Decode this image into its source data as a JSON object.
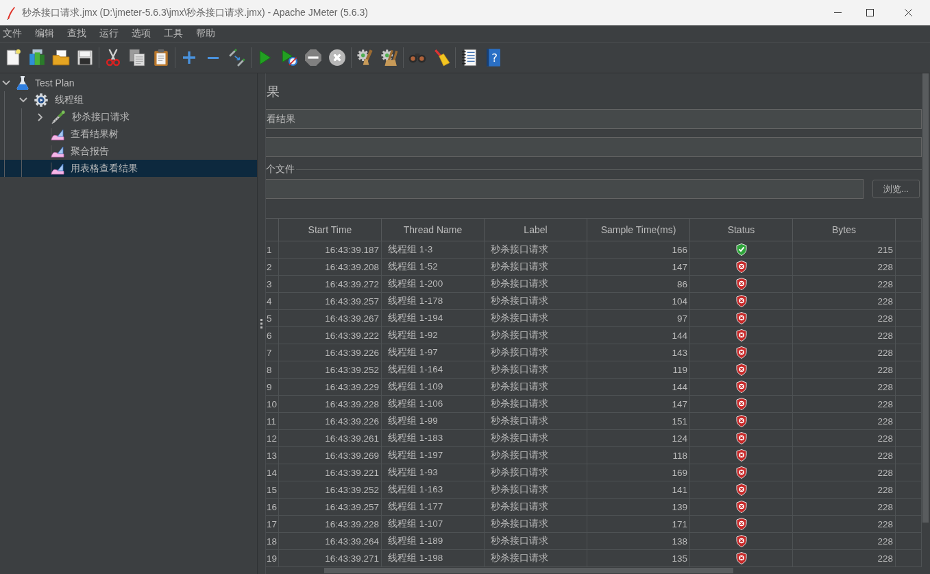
{
  "window": {
    "title": "秒杀接口请求.jmx (D:\\jmeter-5.6.3\\jmx\\秒杀接口请求.jmx) - Apache JMeter (5.6.3)"
  },
  "menu": [
    "文件",
    "编辑",
    "查找",
    "运行",
    "选项",
    "工具",
    "帮助"
  ],
  "toolbar": [
    {
      "buttons": [
        {
          "kind": "new",
          "disabled": false
        },
        {
          "kind": "templates",
          "disabled": false
        },
        {
          "kind": "open",
          "disabled": false
        },
        {
          "kind": "save",
          "disabled": false
        }
      ]
    },
    {
      "buttons": [
        {
          "kind": "cut",
          "disabled": false
        },
        {
          "kind": "copy",
          "disabled": false
        },
        {
          "kind": "paste",
          "disabled": false
        }
      ]
    },
    {
      "buttons": [
        {
          "kind": "expand",
          "disabled": false
        },
        {
          "kind": "collapse",
          "disabled": false
        },
        {
          "kind": "toggle",
          "disabled": false
        }
      ]
    },
    {
      "buttons": [
        {
          "kind": "start",
          "disabled": false
        },
        {
          "kind": "start-no-pauses",
          "disabled": false
        },
        {
          "kind": "stop",
          "disabled": true
        },
        {
          "kind": "shutdown",
          "disabled": true
        }
      ]
    },
    {
      "buttons": [
        {
          "kind": "clear",
          "disabled": false
        },
        {
          "kind": "clear-all",
          "disabled": false
        }
      ]
    },
    {
      "buttons": [
        {
          "kind": "search",
          "disabled": false
        },
        {
          "kind": "reset-search",
          "disabled": false
        }
      ]
    },
    {
      "buttons": [
        {
          "kind": "function-helper",
          "disabled": false
        },
        {
          "kind": "help",
          "disabled": false,
          "glyph": "?"
        }
      ]
    }
  ],
  "tree": [
    {
      "label": "Test Plan",
      "kind": "test-plan",
      "expanded": true,
      "selected": false,
      "children": [
        {
          "label": "线程组",
          "kind": "thread-group",
          "expanded": true,
          "selected": false,
          "children": [
            {
              "label": "秒杀接口请求",
              "kind": "sampler",
              "expanded": false,
              "selected": false
            },
            {
              "label": "查看结果树",
              "kind": "listener",
              "selected": false
            },
            {
              "label": "聚合报告",
              "kind": "listener",
              "selected": false
            },
            {
              "label": "用表格查看结果",
              "kind": "listener",
              "selected": true
            }
          ]
        }
      ]
    }
  ],
  "editor": {
    "title": "果",
    "name_value": "看结果",
    "file_section_label": "个文件",
    "browse_button": "浏览..."
  },
  "table": {
    "columns": [
      "Start Time",
      "Thread Name",
      "Label",
      "Sample Time(ms)",
      "Status",
      "Bytes"
    ],
    "rows": [
      {
        "number": "1",
        "start_time": "16:43:39.187",
        "thread_name": "线程组 1-3",
        "label": "秒杀接口请求",
        "sample_time": "166",
        "success": true,
        "bytes": "215"
      },
      {
        "number": "2",
        "start_time": "16:43:39.208",
        "thread_name": "线程组 1-52",
        "label": "秒杀接口请求",
        "sample_time": "147",
        "success": false,
        "bytes": "228"
      },
      {
        "number": "3",
        "start_time": "16:43:39.272",
        "thread_name": "线程组 1-200",
        "label": "秒杀接口请求",
        "sample_time": "86",
        "success": false,
        "bytes": "228"
      },
      {
        "number": "4",
        "start_time": "16:43:39.257",
        "thread_name": "线程组 1-178",
        "label": "秒杀接口请求",
        "sample_time": "104",
        "success": false,
        "bytes": "228"
      },
      {
        "number": "5",
        "start_time": "16:43:39.267",
        "thread_name": "线程组 1-194",
        "label": "秒杀接口请求",
        "sample_time": "97",
        "success": false,
        "bytes": "228"
      },
      {
        "number": "6",
        "start_time": "16:43:39.222",
        "thread_name": "线程组 1-92",
        "label": "秒杀接口请求",
        "sample_time": "144",
        "success": false,
        "bytes": "228"
      },
      {
        "number": "7",
        "start_time": "16:43:39.226",
        "thread_name": "线程组 1-97",
        "label": "秒杀接口请求",
        "sample_time": "143",
        "success": false,
        "bytes": "228"
      },
      {
        "number": "8",
        "start_time": "16:43:39.252",
        "thread_name": "线程组 1-164",
        "label": "秒杀接口请求",
        "sample_time": "119",
        "success": false,
        "bytes": "228"
      },
      {
        "number": "9",
        "start_time": "16:43:39.229",
        "thread_name": "线程组 1-109",
        "label": "秒杀接口请求",
        "sample_time": "144",
        "success": false,
        "bytes": "228"
      },
      {
        "number": "10",
        "start_time": "16:43:39.228",
        "thread_name": "线程组 1-106",
        "label": "秒杀接口请求",
        "sample_time": "147",
        "success": false,
        "bytes": "228"
      },
      {
        "number": "11",
        "start_time": "16:43:39.226",
        "thread_name": "线程组 1-99",
        "label": "秒杀接口请求",
        "sample_time": "151",
        "success": false,
        "bytes": "228"
      },
      {
        "number": "12",
        "start_time": "16:43:39.261",
        "thread_name": "线程组 1-183",
        "label": "秒杀接口请求",
        "sample_time": "124",
        "success": false,
        "bytes": "228"
      },
      {
        "number": "13",
        "start_time": "16:43:39.269",
        "thread_name": "线程组 1-197",
        "label": "秒杀接口请求",
        "sample_time": "118",
        "success": false,
        "bytes": "228"
      },
      {
        "number": "14",
        "start_time": "16:43:39.221",
        "thread_name": "线程组 1-93",
        "label": "秒杀接口请求",
        "sample_time": "169",
        "success": false,
        "bytes": "228"
      },
      {
        "number": "15",
        "start_time": "16:43:39.252",
        "thread_name": "线程组 1-163",
        "label": "秒杀接口请求",
        "sample_time": "141",
        "success": false,
        "bytes": "228"
      },
      {
        "number": "16",
        "start_time": "16:43:39.257",
        "thread_name": "线程组 1-177",
        "label": "秒杀接口请求",
        "sample_time": "139",
        "success": false,
        "bytes": "228"
      },
      {
        "number": "17",
        "start_time": "16:43:39.228",
        "thread_name": "线程组 1-107",
        "label": "秒杀接口请求",
        "sample_time": "171",
        "success": false,
        "bytes": "228"
      },
      {
        "number": "18",
        "start_time": "16:43:39.264",
        "thread_name": "线程组 1-189",
        "label": "秒杀接口请求",
        "sample_time": "138",
        "success": false,
        "bytes": "228"
      },
      {
        "number": "19",
        "start_time": "16:43:39.271",
        "thread_name": "线程组 1-198",
        "label": "秒杀接口请求",
        "sample_time": "135",
        "success": false,
        "bytes": "228"
      }
    ]
  }
}
